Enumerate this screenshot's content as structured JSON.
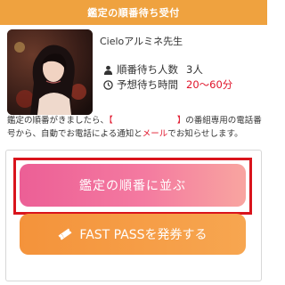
{
  "header": {
    "title": "鑑定の順番待ち受付"
  },
  "teacher": {
    "name": "Cieloアルミネ先生",
    "avatar_icon": "teacher-portrait-image"
  },
  "stats": [
    {
      "icon": "person-icon",
      "label": "順番待ち人数",
      "value": "3人",
      "value_color": "#333333"
    },
    {
      "icon": "clock-icon",
      "label": "予想待ち時間",
      "value": "20〜60分",
      "value_color": "#e0142a"
    }
  ],
  "notice": {
    "part1": "鑑定の順番がきましたら、",
    "bracket_open": "【",
    "bracket_close": "】",
    "part2": "の番組専用の電話番号から、自動でお電話による通知と",
    "mail": "メール",
    "part3": "でお知らせします。"
  },
  "buttons": {
    "queue_label": "鑑定の順番に並ぶ",
    "fastpass_label": "FAST PASSを発券する",
    "fastpass_icon": "ticket-icon"
  },
  "colors": {
    "header_bg": "#efa23f",
    "accent_red": "#e0142a",
    "queue_gradient_start": "#ec5f96",
    "fastpass_bg": "#f4933b"
  }
}
